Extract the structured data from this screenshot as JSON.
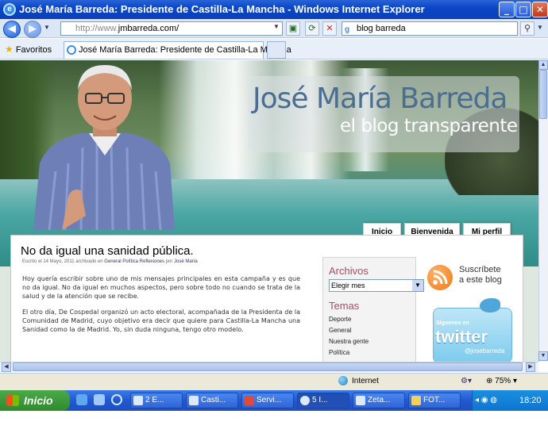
{
  "window": {
    "title": "José María Barreda: Presidente de Castilla-La Mancha - Windows Internet Explorer"
  },
  "toolbar": {
    "url_prefix": "http://www.",
    "url_domain": "jmbarreda.com/",
    "search_value": "blog barreda",
    "favorites_label": "Favoritos",
    "tab_title": "José María Barreda: Presidente de Castilla-La Mancha"
  },
  "site": {
    "title": "José María Barreda",
    "subtitle": "el blog transparente",
    "nav": [
      "Inicio",
      "Bienvenida",
      "Mi perfil"
    ]
  },
  "post": {
    "title": "No da igual una sanidad pública.",
    "meta_prefix": "Escrito el 14 Mayo, 2011 archivado en",
    "meta_categories": "General Política Reflexiones",
    "meta_by": "por",
    "meta_author": "José María",
    "paragraphs": [
      "Hoy quería escribir sobre uno de mis mensajes principales en esta campaña y es que no da igual. No da igual en muchos aspectos, pero sobre todo no cuando se trata de la salud y de la atención que se recibe.",
      "El otro día, De Cospedal organizó un acto electoral, acompañada de la Presidenta de la Comunidad de Madrid, cuyo objetivo era decir que quiere para Castilla-La Mancha una Sanidad como la de Madrid. Yo, sin duda ninguna, tengo otro modelo."
    ]
  },
  "sidebar": {
    "archivos_heading": "Archivos",
    "archivos_select": "Elegir mes",
    "temas_heading": "Temas",
    "temas": [
      "Deporte",
      "General",
      "Nuestra gente",
      "Política"
    ],
    "rss_text_1": "Suscríbete",
    "rss_text_2": "a este blog",
    "twitter_follow": "Síguenos en",
    "twitter_logo": "twitter",
    "twitter_handle": "@josebarreda"
  },
  "status": {
    "zone": "Internet",
    "zoom": "75%"
  },
  "taskbar": {
    "start": "Inicio",
    "items": [
      "2 E...",
      "Casti...",
      "Servi...",
      "5 I...",
      "Zeta...",
      "FOT..."
    ],
    "clock": "18:20"
  },
  "colors": {
    "titlebar": "#0b47c7",
    "accent_title": "#4b6d90",
    "sidebar_heading": "#b04a66",
    "twitter": "#7ccbee"
  }
}
